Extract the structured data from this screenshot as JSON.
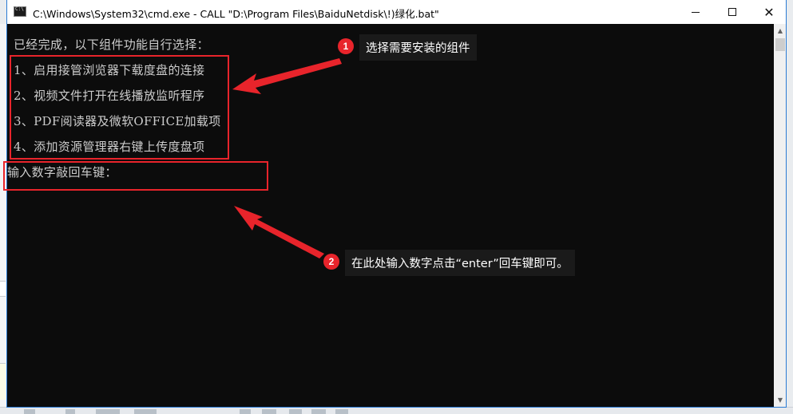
{
  "window": {
    "title": "C:\\Windows\\System32\\cmd.exe - CALL  \"D:\\Program Files\\BaiduNetdisk\\!)绿化.bat\"",
    "icon": "cmd-icon",
    "controls": {
      "minimize": "minimize-icon",
      "maximize": "maximize-icon",
      "close": "close-icon"
    }
  },
  "console": {
    "lines": [
      "已经完成，以下组件功能自行选择：",
      "1、启用接管浏览器下载度盘的连接",
      "2、视频文件打开在线播放监听程序",
      "3、PDF阅读器及微软OFFICE加载项",
      "4、添加资源管理器右键上传度盘项",
      "输入数字敲回车键："
    ]
  },
  "annotations": {
    "callout1": {
      "number": "1",
      "text": "选择需要安装的组件"
    },
    "callout2": {
      "number": "2",
      "text": "在此处输入数字点击“enter”回车键即可。"
    }
  },
  "colors": {
    "console_bg": "#0c0c0c",
    "console_text": "#cccccc",
    "annotation_red": "#e8242b",
    "callout_bg": "#1a1a1a",
    "window_border": "#2b7bd4"
  }
}
